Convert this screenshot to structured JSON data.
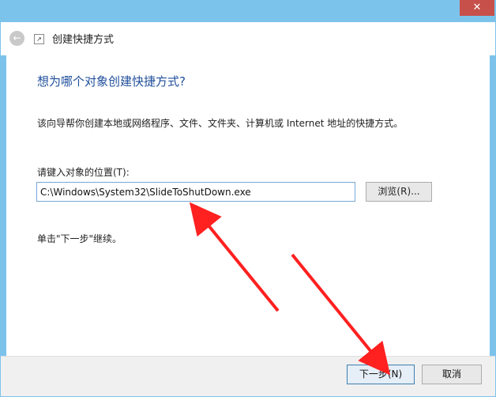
{
  "titlebar": {
    "close_glyph": "✕",
    "close_icon": "close-icon"
  },
  "header": {
    "back_glyph": "←",
    "back_icon": "back-arrow-icon",
    "shortcut_glyph": "↗",
    "shortcut_icon": "shortcut-icon",
    "title": "创建快捷方式"
  },
  "main": {
    "heading": "想为哪个对象创建快捷方式?",
    "description": "该向导帮你创建本地或网络程序、文件、文件夹、计算机或 Internet 地址的快捷方式。",
    "location_label": "请键入对象的位置(T):",
    "location_value": "C:\\Windows\\System32\\SlideToShutDown.exe",
    "browse_label": "浏览(R)...",
    "hint": "单击\"下一步\"继续。"
  },
  "footer": {
    "next_label": "下一步(N)",
    "cancel_label": "取消"
  },
  "annotations": {
    "arrow_color": "#ff2020"
  },
  "colors": {
    "frame": "#7cc3ec",
    "heading": "#1f4e9b",
    "close": "#c7504a"
  }
}
